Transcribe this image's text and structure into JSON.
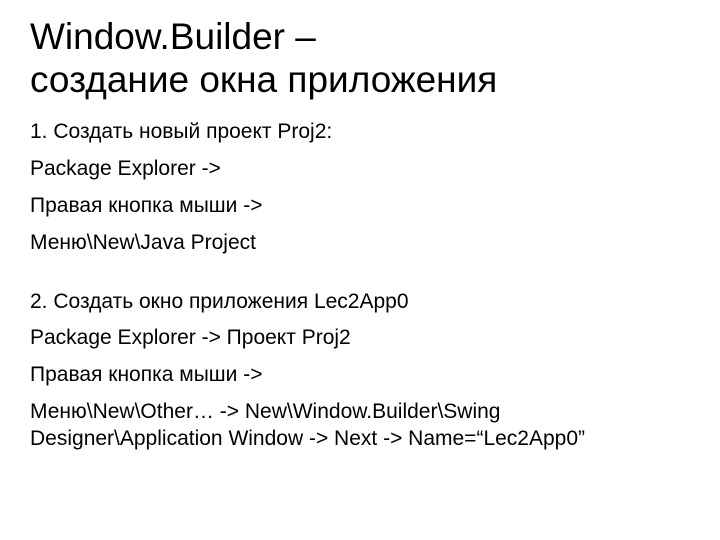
{
  "title_line1": "Window.Builder –",
  "title_line2": "создание окна приложения",
  "section1": {
    "item1": "1.  Создать новый проект Proj2:",
    "line2": "Package Explorer ->",
    "line3": "Правая кнопка мыши ->",
    "line4": "Меню\\New\\Java Project"
  },
  "section2": {
    "line1": "2. Создать окно приложения Lec2App0",
    "line2": "Package Explorer -> Проект Proj2",
    "line3": "Правая кнопка мыши ->",
    "line4": "Меню\\New\\Other… -> New\\Window.Builder\\Swing Designer\\Application Window -> Next -> Name=“Lec2App0”"
  }
}
